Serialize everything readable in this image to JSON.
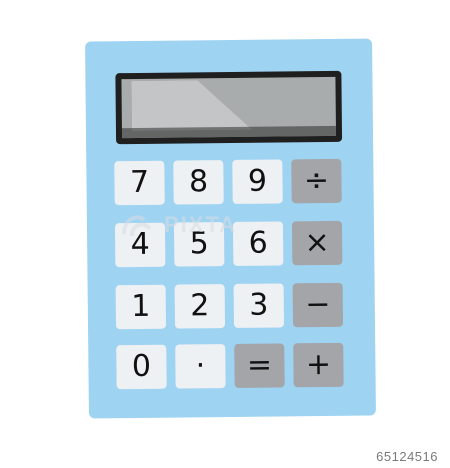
{
  "colors": {
    "background": "#ffffff",
    "body": "#9fd3f2",
    "display_bezel": "#1f1f1f",
    "display_screen": "#a9acad",
    "display_shine": "#d9dadb",
    "key_light": "#eef1f3",
    "key_dark": "#a3a5a8",
    "key_text": "#111111",
    "watermark": "#d8dde2",
    "id_text": "#7a7a7a"
  },
  "keys": [
    {
      "label": "7",
      "tone": "light"
    },
    {
      "label": "8",
      "tone": "light"
    },
    {
      "label": "9",
      "tone": "light"
    },
    {
      "label": "÷",
      "tone": "dark"
    },
    {
      "label": "4",
      "tone": "light"
    },
    {
      "label": "5",
      "tone": "light"
    },
    {
      "label": "6",
      "tone": "light"
    },
    {
      "label": "×",
      "tone": "dark"
    },
    {
      "label": "1",
      "tone": "light"
    },
    {
      "label": "2",
      "tone": "light"
    },
    {
      "label": "3",
      "tone": "light"
    },
    {
      "label": "−",
      "tone": "dark"
    },
    {
      "label": "0",
      "tone": "light"
    },
    {
      "label": "·",
      "tone": "light"
    },
    {
      "label": "=",
      "tone": "dark"
    },
    {
      "label": "+",
      "tone": "dark"
    }
  ],
  "watermark": {
    "text": "PIXTA",
    "icon": "pixta-logo-icon"
  },
  "image_id": "65124516"
}
